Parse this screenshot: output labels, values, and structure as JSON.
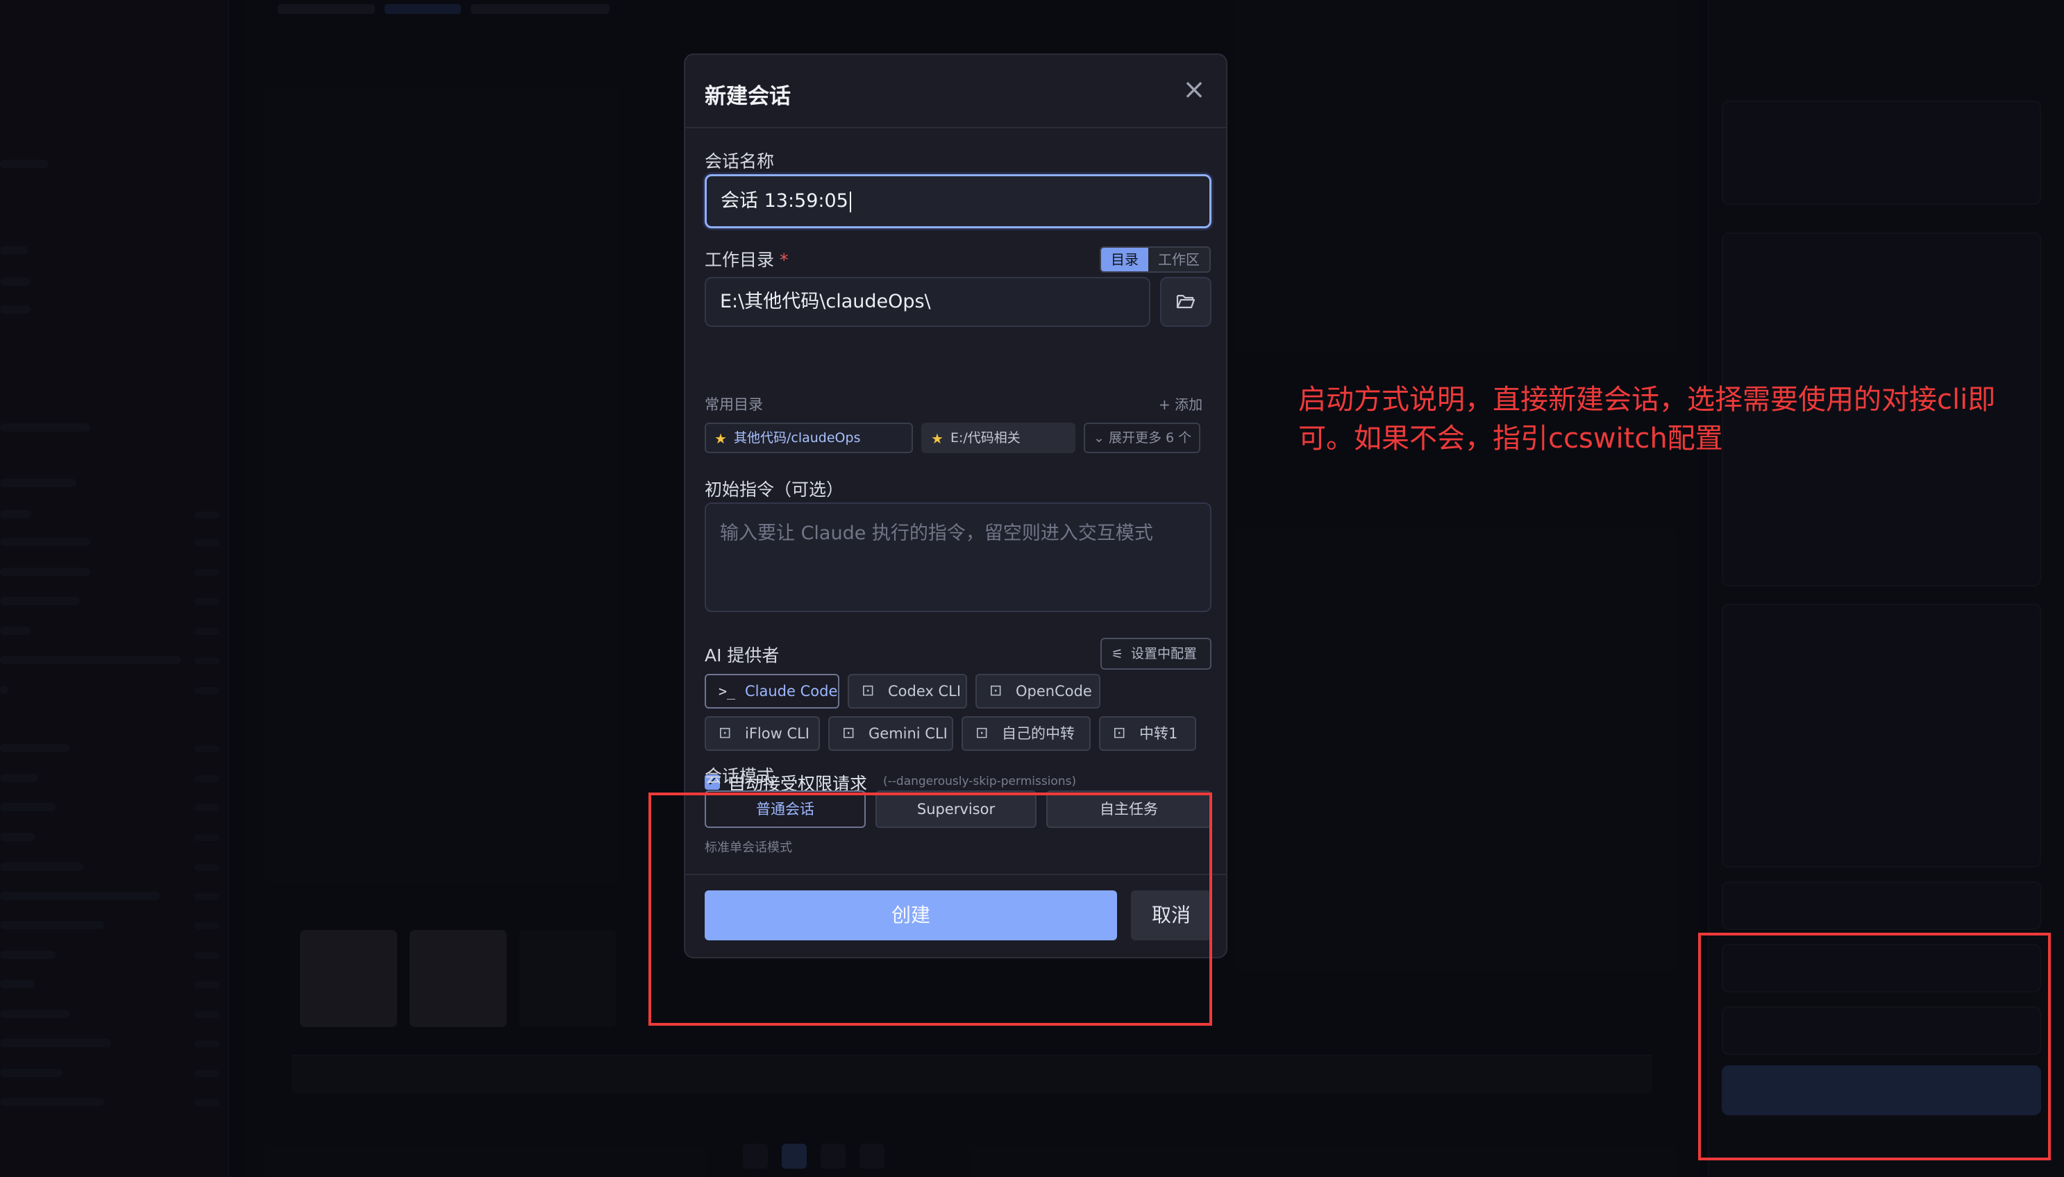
{
  "modal": {
    "title": "新建会话",
    "close_icon": "close-icon",
    "session_name": {
      "label": "会话名称",
      "value": "会话 13:59:05"
    },
    "workdir": {
      "label": "工作目录",
      "required_mark": "*",
      "toggle": [
        "目录",
        "工作区"
      ],
      "toggle_selected": "目录",
      "value": "E:\\其他代码\\claudeOps\\",
      "browse_icon": "folder-open-icon"
    },
    "common_dirs": {
      "label": "常用目录",
      "add_label": "+ 添加",
      "chips": [
        "其他代码/claudeOps",
        "E:/代码相关"
      ],
      "more_label": "展开更多 6 个"
    },
    "initial_command": {
      "label": "初始指令（可选）",
      "placeholder": "输入要让 Claude 执行的指令，留空则进入交互模式"
    },
    "ai_provider": {
      "label": "AI 提供者",
      "config_button": "设置中配置",
      "providers": [
        "Claude Code",
        "Codex CLI",
        "OpenCode",
        "iFlow CLI",
        "Gemini CLI",
        "自己的中转",
        "中转1"
      ],
      "selected": "Claude Code"
    },
    "auto_accept": {
      "checked": true,
      "label": "自动接受权限请求",
      "hint": "(--dangerously-skip-permissions)"
    },
    "session_mode": {
      "label": "会话模式",
      "modes": [
        "普通会话",
        "Supervisor",
        "自主任务"
      ],
      "selected": "普通会话",
      "hint": "标准单会话模式"
    },
    "create_button": "创建",
    "cancel_button": "取消"
  },
  "annotation": {
    "text": "启动方式说明，直接新建会话，选择需要使用的对接cli即可。如果不会，指引ccswitch配置",
    "color": "#ef3a3a"
  },
  "colors": {
    "accent": "#86a9fb",
    "accent_text": "#9db7ff",
    "modal_bg": "#1b1c26",
    "page_bg": "#0d0e14"
  }
}
